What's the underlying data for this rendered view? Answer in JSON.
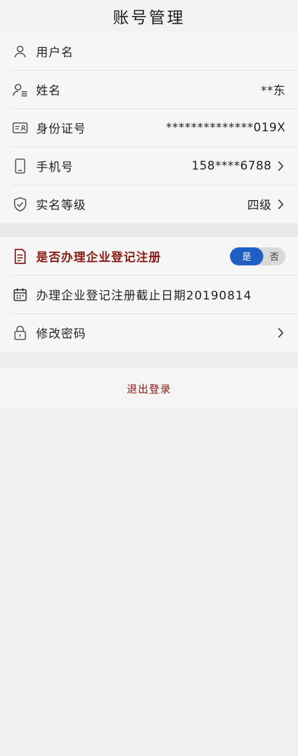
{
  "header": {
    "title": "账号管理"
  },
  "info": {
    "username_label": "用户名",
    "name_label": "姓名",
    "name_value": "**东",
    "id_label": "身份证号",
    "id_value": "**************019X",
    "phone_label": "手机号",
    "phone_value": "158****6788",
    "level_label": "实名等级",
    "level_value": "四级"
  },
  "enterprise": {
    "question_label": "是否办理企业登记注册",
    "yes": "是",
    "no": "否",
    "selected": "是",
    "deadline_label": "办理企业登记注册截止日期20190814",
    "password_label": "修改密码"
  },
  "logout": {
    "label": "退出登录"
  },
  "colors": {
    "accent_red": "#8b1a14",
    "toggle_blue": "#1f5fc4"
  }
}
